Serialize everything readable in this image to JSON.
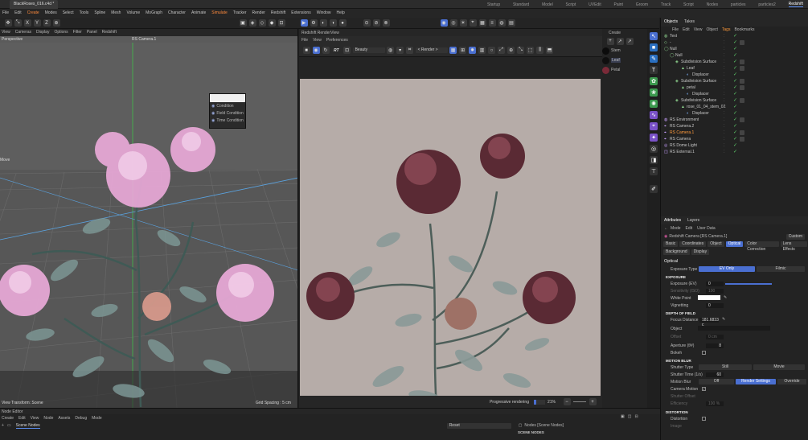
{
  "window": {
    "doc_tab": "BlackRoses_016.c4d *"
  },
  "layouts": [
    "Startup",
    "Standard",
    "Model",
    "Script",
    "UVEdit",
    "Paint",
    "Groom",
    "Track",
    "Script",
    "Nodes",
    "particles",
    "particles2",
    "Redshift"
  ],
  "menu": [
    "File",
    "Edit",
    "Create",
    "Modes",
    "Select",
    "Tools",
    "Spline",
    "Mesh",
    "Volume",
    "MoGraph",
    "Character",
    "Animate",
    "Simulate",
    "Tracker",
    "Render",
    "Redshift",
    "Extensions",
    "Window",
    "Help"
  ],
  "viewport": {
    "menu": [
      "View",
      "Cameras",
      "Display",
      "Options",
      "Filter",
      "Panel",
      "Redshift"
    ],
    "view_name": "Perspective",
    "camera": "RS Camera.1",
    "move_label": "Move",
    "transform": "View Transform: Scene",
    "grid": "Grid Spacing : 5 cm",
    "popup": [
      "Condition",
      "Field Condition",
      "Time Condition"
    ]
  },
  "renderview": {
    "title": "Redshift RenderView",
    "menu": [
      "File",
      "View",
      "Preferences"
    ],
    "aov": "Beauty",
    "render_mode": "< Render >",
    "rt": "RT",
    "progress_label": "Progressive rendering",
    "progress_pct": "21%",
    "progress": 0.21
  },
  "materials": {
    "create": "Create",
    "items": [
      "Stem",
      "Leaf",
      "Petal"
    ]
  },
  "objects": {
    "tabs": [
      "Objects",
      "Takes"
    ],
    "menu": [
      "File",
      "Edit",
      "View",
      "Object",
      "Tags",
      "Bookmarks"
    ],
    "rows": [
      {
        "name": "Text",
        "depth": 0,
        "color": "white"
      },
      {
        "name": "-",
        "depth": 0,
        "color": "white"
      },
      {
        "name": "Null",
        "depth": 0,
        "color": "white"
      },
      {
        "name": "Null",
        "depth": 1,
        "color": "white"
      },
      {
        "name": "Subdivision Surface",
        "depth": 2,
        "color": "white"
      },
      {
        "name": "Leaf",
        "depth": 3,
        "color": "white"
      },
      {
        "name": "Displacer",
        "depth": 4,
        "color": "white"
      },
      {
        "name": "Subdivision Surface",
        "depth": 2,
        "color": "white"
      },
      {
        "name": "petal",
        "depth": 3,
        "color": "white"
      },
      {
        "name": "Displacer",
        "depth": 4,
        "color": "white"
      },
      {
        "name": "Subdivision Surface",
        "depth": 2,
        "color": "white"
      },
      {
        "name": "rose_01_04_stem_02.1",
        "depth": 3,
        "color": "white"
      },
      {
        "name": "Displacer",
        "depth": 4,
        "color": "white"
      },
      {
        "name": "RS Environment",
        "depth": 0,
        "color": "white"
      },
      {
        "name": "RS Camera.2",
        "depth": 0,
        "color": "white"
      },
      {
        "name": "RS Camera.1",
        "depth": 0,
        "color": "orange"
      },
      {
        "name": "RS Camera",
        "depth": 0,
        "color": "white"
      },
      {
        "name": "RS Dome Light",
        "depth": 0,
        "color": "white"
      },
      {
        "name": "RS External.1",
        "depth": 0,
        "color": "white"
      }
    ]
  },
  "attributes": {
    "tabs": [
      "Attributes",
      "Layers"
    ],
    "menu": [
      "Mode",
      "Edit",
      "User Data"
    ],
    "object": "Redshift Camera [RS Camera.1]",
    "custom": "Custom",
    "subtabs1": [
      "Basic",
      "Coordinates",
      "Object",
      "Optical",
      "Color Correction",
      "Lens Effects"
    ],
    "subtabs2": [
      "Background",
      "Display"
    ],
    "section": "Optical",
    "exposure_type_label": "Exposure Type",
    "exposure_type_options": [
      "EV Only",
      "Filmic"
    ],
    "exposure": "EXPOSURE",
    "exposure_ev_label": "Exposure (EV)",
    "exposure_ev": "0",
    "sensitivity_label": "Sensitivity (ISO)",
    "sensitivity": "100",
    "white_point_label": "White Point",
    "vignetting_label": "Vignetting",
    "vignetting": "0",
    "dof": "DEPTH OF FIELD",
    "focus_label": "Focus Distance",
    "focus": "181.6833 c",
    "object_label": "Object",
    "offset_label": "Offset",
    "offset": "0 cm",
    "aperture_label": "Aperture (f/#)",
    "aperture": "8",
    "bokeh_label": "Bokeh",
    "motion": "MOTION BLUR",
    "shutter_type_label": "Shutter Type",
    "shutter_type_options": [
      "Still",
      "Movie"
    ],
    "shutter_time_label": "Shutter Time (1/s)",
    "shutter_time": "60",
    "motion_blur_label": "Motion Blur",
    "motion_blur_options": [
      "Off",
      "Render Settings",
      "Override"
    ],
    "camera_motion_label": "Camera Motion",
    "shutter_offset_label": "Shutter Offset",
    "efficiency_label": "Efficiency",
    "efficiency": "100 %",
    "distortion": "DISTORTION",
    "distortion_label": "Distortion",
    "image_label": "Image"
  },
  "node_editor": {
    "title": "Node Editor",
    "menu": [
      "Create",
      "Edit",
      "View",
      "Node",
      "Assets",
      "Debug",
      "Mode"
    ],
    "scene_nodes": "Scene Nodes",
    "reset": "Reset",
    "path": "Nodes [Scene Nodes]",
    "header": "SCENE NODES"
  },
  "colors": {
    "accent": "#4a6fd1",
    "highlight": "#ff9b3d",
    "check": "#5ecb6a",
    "render_bg": "#b6aca8"
  }
}
